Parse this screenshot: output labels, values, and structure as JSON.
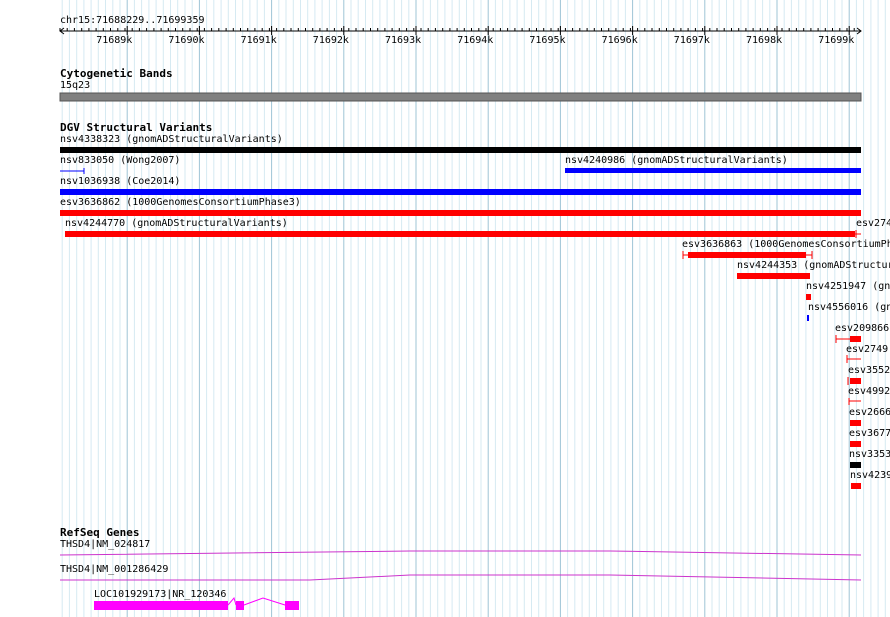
{
  "ruler": {
    "position": "chr15:71688229..71699359",
    "ticks": [
      "71689k",
      "71690k",
      "71691k",
      "71692k",
      "71693k",
      "71694k",
      "71695k",
      "71696k",
      "71697k",
      "71698k",
      "71699k"
    ]
  },
  "cytoband": {
    "title": "Cytogenetic Bands",
    "band": "15q23"
  },
  "dgv": {
    "title": "DGV Structural Variants",
    "features": [
      {
        "label": "nsv4338323 (gnomADStructuralVariants)",
        "color": "#000000"
      },
      {
        "label": "nsv833050 (Wong2007)",
        "color": "#0000ff"
      },
      {
        "label": "nsv4240986 (gnomADStructuralVariants)",
        "color": "#0000ff"
      },
      {
        "label": "nsv1036938 (Coe2014)",
        "color": "#0000ff"
      },
      {
        "label": "esv3636862 (1000GenomesConsortiumPhase3)",
        "color": "#ff0000"
      },
      {
        "label": "nsv4244770 (gnomADStructuralVariants)",
        "color": "#ff0000"
      },
      {
        "label": "esv274",
        "color": "#ff0000"
      },
      {
        "label": "esv3636863 (1000GenomesConsortiumPh",
        "color": "#ff0000"
      },
      {
        "label": "nsv4244353 (gnomADStructur",
        "color": "#ff0000"
      },
      {
        "label": "nsv4251947 (gnc",
        "color": "#ff0000"
      },
      {
        "label": "nsv4556016 (gn",
        "color": "#0000ff"
      },
      {
        "label": "esv209866",
        "color": "#ff0000"
      },
      {
        "label": "esv2749",
        "color": "#ff0000"
      },
      {
        "label": "esv3552",
        "color": "#ff0000"
      },
      {
        "label": "esv4992",
        "color": "#ff0000"
      },
      {
        "label": "esv2666",
        "color": "#ff0000"
      },
      {
        "label": "esv3677",
        "color": "#ff0000"
      },
      {
        "label": "nsv3353",
        "color": "#000000"
      },
      {
        "label": "nsv4239",
        "color": "#ff0000"
      }
    ]
  },
  "refseq": {
    "title": "RefSeq Genes",
    "genes": [
      {
        "label": "THSD4|NM_024817",
        "color": "#cc33cc"
      },
      {
        "label": "THSD4|NM_001286429",
        "color": "#cc33cc"
      },
      {
        "label": "LOC101929173|NR_120346",
        "color": "#ff00ff"
      }
    ]
  }
}
